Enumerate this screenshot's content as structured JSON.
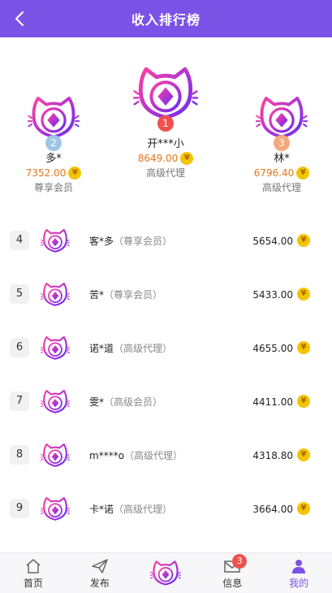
{
  "header": {
    "title": "收入排行榜"
  },
  "podium": [
    {
      "rank": "1",
      "name": "开***小",
      "amount": "8649.00",
      "role": "高级代理",
      "badge_color": "#f0514d"
    },
    {
      "rank": "2",
      "name": "多*",
      "amount": "7352.00",
      "role": "尊享会员",
      "badge_color": "#9fc6e8"
    },
    {
      "rank": "3",
      "name": "林*",
      "amount": "6796.40",
      "role": "高级代理",
      "badge_color": "#f4a87a"
    }
  ],
  "coin_symbol": "¥",
  "list": [
    {
      "rank": "4",
      "name": "客*多",
      "level": "（尊享会员）",
      "amount": "5654.00"
    },
    {
      "rank": "5",
      "name": "苦*",
      "level": "（尊享会员）",
      "amount": "5433.00"
    },
    {
      "rank": "6",
      "name": "诺*道",
      "level": "（高级代理）",
      "amount": "4655.00"
    },
    {
      "rank": "7",
      "name": "雯*",
      "level": "（高级会员）",
      "amount": "4411.00"
    },
    {
      "rank": "8",
      "name": "m****o",
      "level": "（高级代理）",
      "amount": "4318.80"
    },
    {
      "rank": "9",
      "name": "卡*诺",
      "level": "（高级代理）",
      "amount": "3664.00"
    }
  ],
  "tabbar": {
    "home": "首页",
    "publish": "发布",
    "messages": "信息",
    "messages_badge": "3",
    "mine": "我的"
  },
  "colors": {
    "accent": "#7a52e6",
    "amount": "#e8751a",
    "coin": "#f4c400"
  }
}
